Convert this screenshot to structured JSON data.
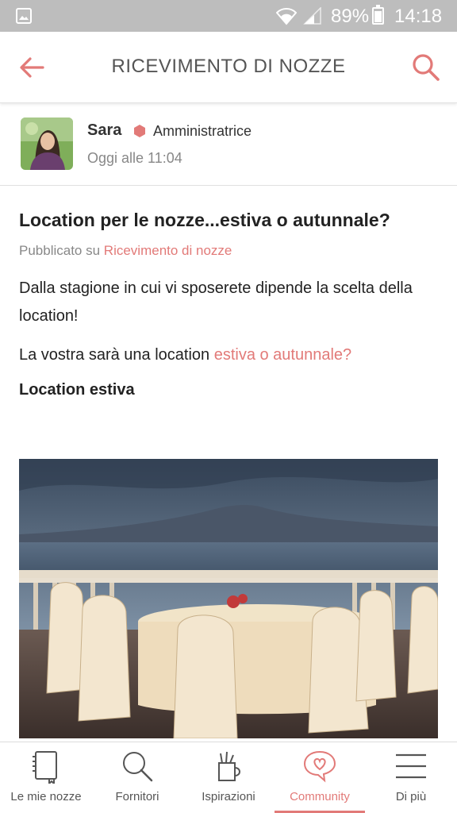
{
  "status_bar": {
    "battery_text": "89%",
    "battery_level": 0.89,
    "time": "14:18"
  },
  "header": {
    "title": "RICEVIMENTO DI NOZZE",
    "back_icon": "arrow-left-icon",
    "search_icon": "search-icon"
  },
  "author": {
    "name": "Sara",
    "role": "Amministratrice",
    "time": "Oggi alle 11:04"
  },
  "post": {
    "title": "Location per le nozze...estiva o autunnale?",
    "published_prefix": "Pubblicato su ",
    "published_link": "Ricevimento di nozze",
    "paragraph1": "Dalla stagione in cui vi sposerete dipende la scelta della location!",
    "paragraph2_prefix": "La vostra sarà una location ",
    "paragraph2_link": "estiva o autunnale?",
    "section_heading": "Location estiva"
  },
  "bottom_nav": {
    "items": [
      {
        "label": "Le mie nozze",
        "icon": "notebook-icon"
      },
      {
        "label": "Fornitori",
        "icon": "search-icon"
      },
      {
        "label": "Ispirazioni",
        "icon": "cup-icon"
      },
      {
        "label": "Community",
        "icon": "chat-heart-icon",
        "active": true
      },
      {
        "label": "Di più",
        "icon": "menu-icon"
      }
    ]
  },
  "colors": {
    "accent": "#e27a78",
    "status_bar": "#bdbdbd"
  }
}
